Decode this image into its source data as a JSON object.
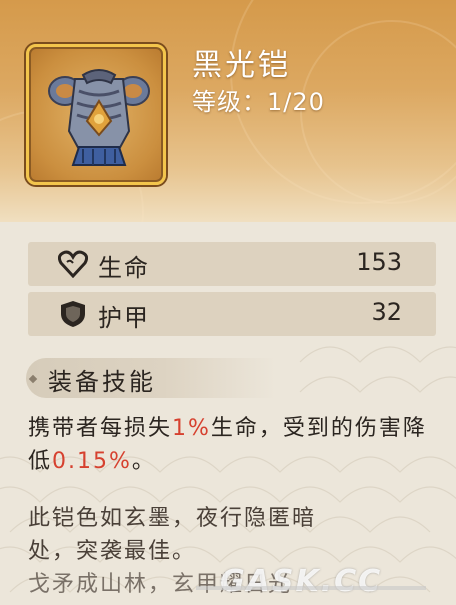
{
  "item": {
    "name": "黑光铠",
    "level_label": "等级：",
    "level_value": "1/20",
    "icon": "armor-chestplate-icon"
  },
  "stats": [
    {
      "label": "生命",
      "value": "153",
      "icon": "heart-icon"
    },
    {
      "label": "护甲",
      "value": "32",
      "icon": "shield-icon"
    }
  ],
  "skill": {
    "section_title": "装备技能",
    "desc_part1": "携带者每损失",
    "desc_hl1": "1%",
    "desc_part2": "生命，受到的伤害降低",
    "desc_hl2": "0.15%",
    "desc_part3": "。"
  },
  "flavor": {
    "line1": "此铠色如玄墨，夜行隐匿暗",
    "line2": "处，突袭最佳。",
    "line3": "戈矛成山林，玄甲耀日光"
  },
  "watermark": "GASK.CC",
  "colors": {
    "highlight": "#d6412f",
    "frame_gold": "#f3c54c",
    "header_orange": "#d59a4b"
  }
}
